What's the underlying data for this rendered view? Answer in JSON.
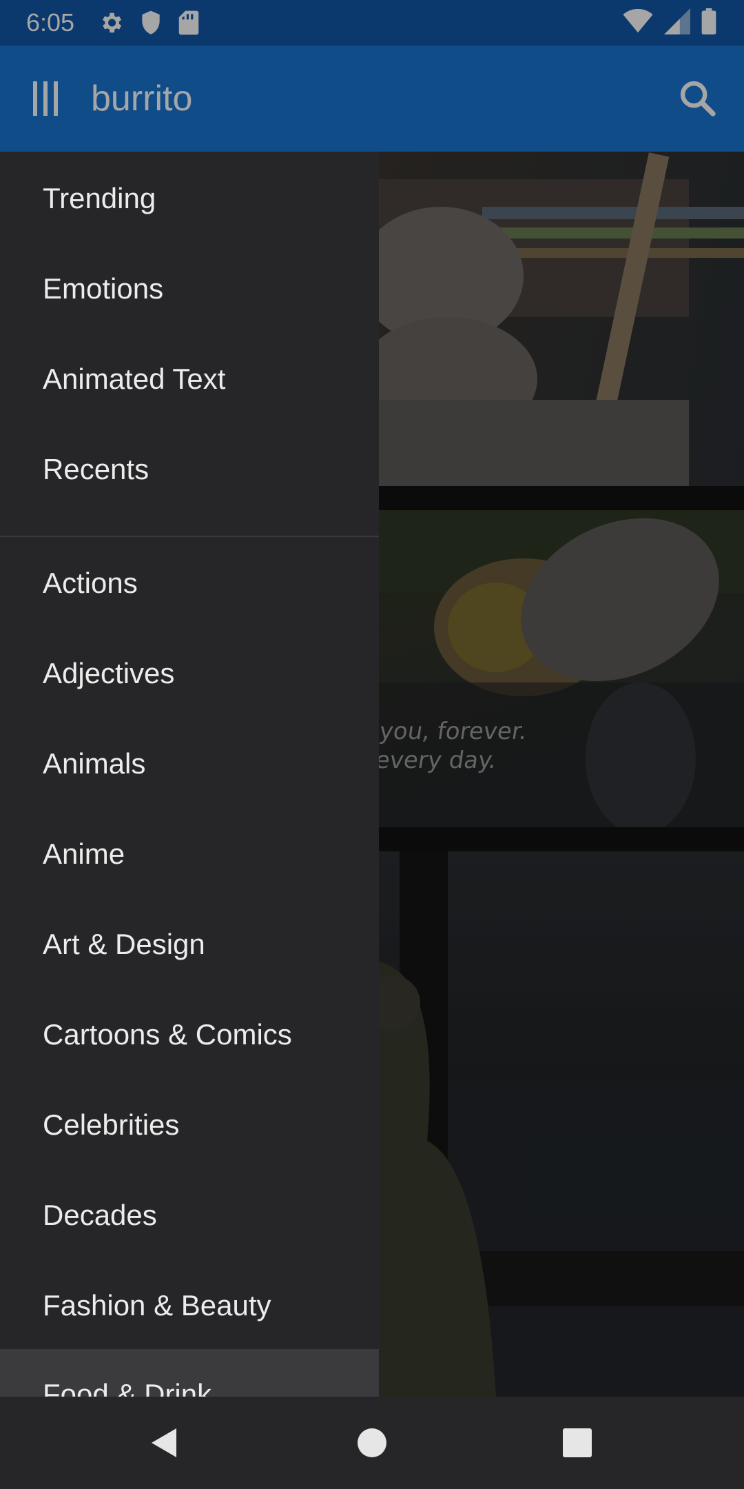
{
  "status_bar": {
    "time": "6:05",
    "left_icons": [
      "settings-icon",
      "shield-icon",
      "sd-card-icon"
    ],
    "right_icons": [
      "wifi-icon",
      "cell-signal-icon",
      "battery-icon"
    ]
  },
  "app_bar": {
    "menu_icon": "menu-icon",
    "search_query": "burrito",
    "search_icon": "search-icon",
    "color": "#1976d2"
  },
  "content": {
    "card2_caption_line1": "you, forever.",
    "card2_caption_line2": "every day."
  },
  "drawer": {
    "items": [
      {
        "label": "Trending"
      },
      {
        "label": "Emotions"
      },
      {
        "label": "Animated Text"
      },
      {
        "label": "Recents"
      },
      {
        "label": "Actions"
      },
      {
        "label": "Adjectives"
      },
      {
        "label": "Animals"
      },
      {
        "label": "Anime"
      },
      {
        "label": "Art & Design"
      },
      {
        "label": "Cartoons & Comics"
      },
      {
        "label": "Celebrities"
      },
      {
        "label": "Decades"
      },
      {
        "label": "Fashion & Beauty"
      },
      {
        "label": "Food & Drink",
        "selected": true
      }
    ],
    "background": "#262628"
  },
  "nav_bar": {
    "back_icon": "back-icon",
    "home_icon": "home-icon",
    "recents_icon": "overview-icon"
  }
}
